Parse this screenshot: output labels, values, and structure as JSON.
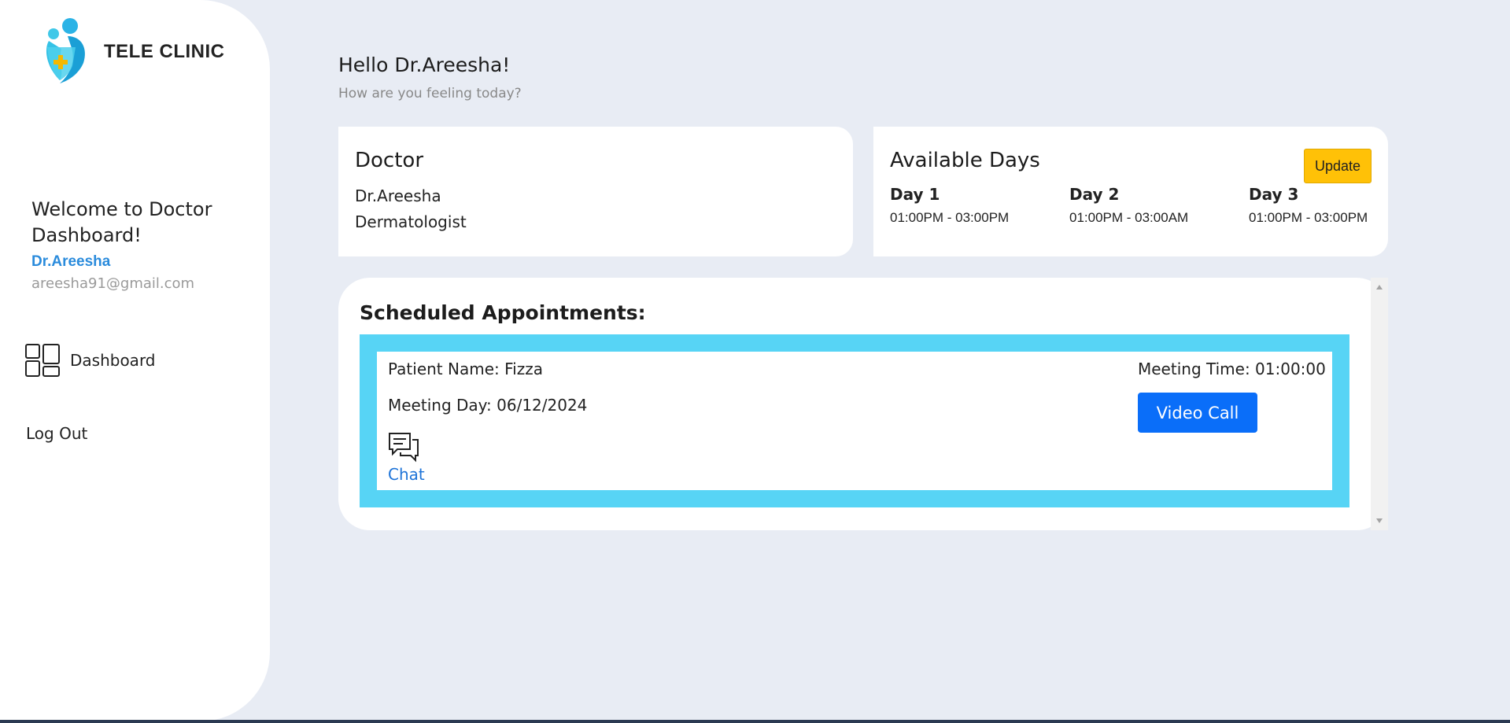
{
  "sidebar": {
    "brand": "TELE CLINIC",
    "welcome_title": "Welcome to Doctor Dashboard!",
    "user_name": "Dr.Areesha",
    "user_email": "areesha91@gmail.com",
    "nav": {
      "dashboard": "Dashboard",
      "logout": "Log Out"
    }
  },
  "header": {
    "greeting": "Hello Dr.Areesha!",
    "subtitle": "How are you feeling today?"
  },
  "doctor_card": {
    "title": "Doctor",
    "name": "Dr.Areesha",
    "specialty": "Dermatologist"
  },
  "days_card": {
    "title": "Available Days",
    "update_label": "Update",
    "days": [
      {
        "label": "Day 1",
        "time": "01:00PM - 03:00PM"
      },
      {
        "label": "Day 2",
        "time": "01:00PM - 03:00AM"
      },
      {
        "label": "Day 3",
        "time": "01:00PM - 03:00PM"
      }
    ]
  },
  "appointments": {
    "title": "Scheduled Appointments:",
    "items": [
      {
        "patient": "Patient Name: Fizza",
        "day": "Meeting Day: 06/12/2024",
        "time": "Meeting Time: 01:00:00",
        "chat_label": "Chat",
        "video_label": "Video Call"
      }
    ]
  },
  "colors": {
    "background": "#e8ecf4",
    "accent_blue": "#0a6ef9",
    "cyan_frame": "#57d4f5",
    "update_yellow": "#ffc107",
    "name_blue": "#2a8bdc"
  },
  "icons": [
    "tele-clinic-logo-icon",
    "dashboard-grid-icon",
    "chat-bubbles-icon"
  ]
}
